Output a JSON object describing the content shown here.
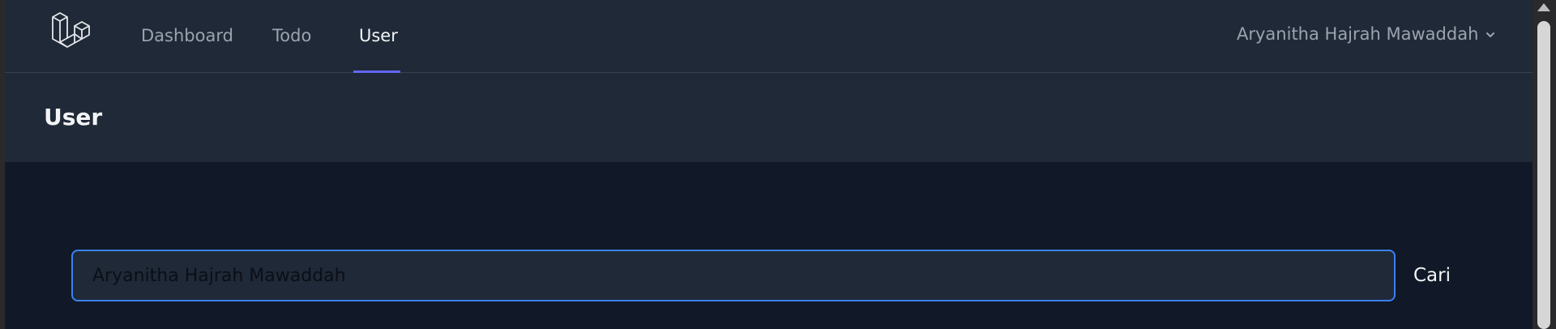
{
  "nav": {
    "links": [
      {
        "label": "Dashboard"
      },
      {
        "label": "Todo"
      },
      {
        "label": "User"
      }
    ],
    "active_index": 2,
    "user_name": "Aryanitha Hajrah Mawaddah"
  },
  "header": {
    "title": "User"
  },
  "search": {
    "value": "Aryanitha Hajrah Mawaddah",
    "button_label": "Cari"
  },
  "colors": {
    "accent": "#6366f1",
    "focus_ring": "#3b82f6",
    "nav_bg": "#1f2937",
    "page_bg": "#111827"
  },
  "icons": {
    "logo": "laravel-logo-icon",
    "user_menu_caret": "chevron-down-icon"
  }
}
